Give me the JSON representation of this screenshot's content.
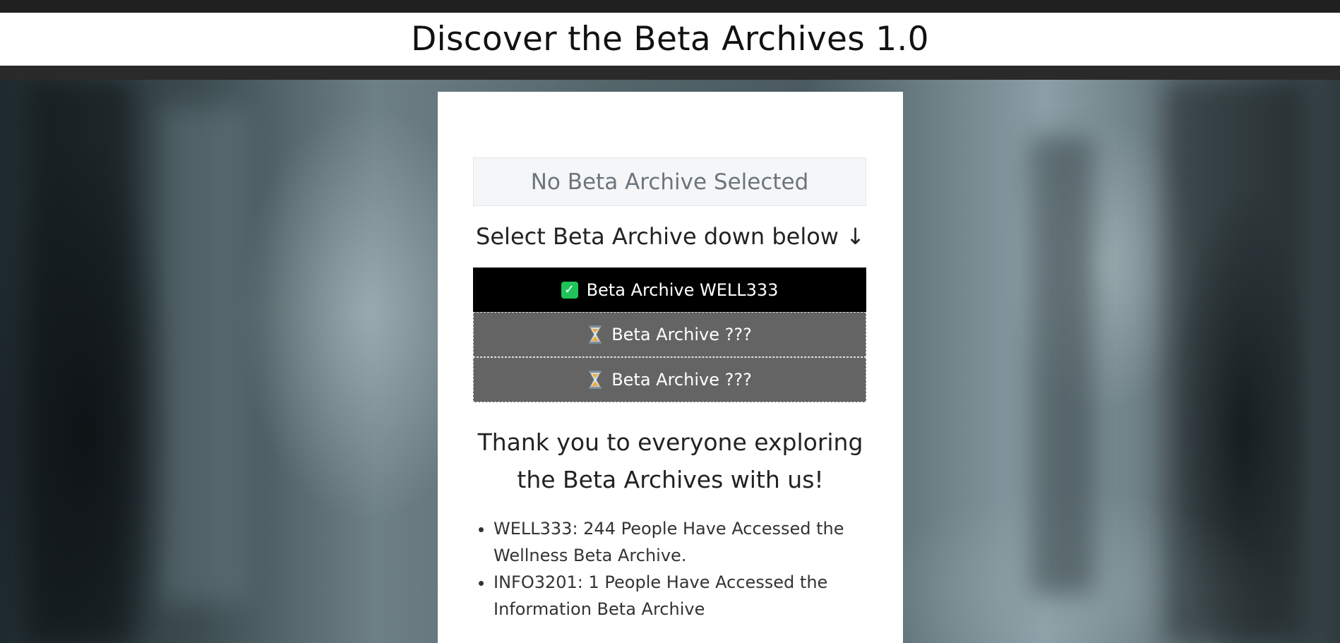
{
  "header": {
    "title": "Discover the Beta Archives 1.0"
  },
  "status": {
    "text": "No Beta Archive Selected"
  },
  "instruction": {
    "text": "Select Beta Archive down below ↓"
  },
  "archives": [
    {
      "label": "Beta Archive WELL333",
      "state": "unlocked",
      "icon": "check-icon"
    },
    {
      "label": "Beta Archive ???",
      "state": "locked",
      "icon": "hourglass-icon"
    },
    {
      "label": "Beta Archive ???",
      "state": "locked",
      "icon": "hourglass-icon"
    }
  ],
  "thanks": {
    "line1": "Thank you to everyone exploring",
    "line2": "the Beta Archives with us!"
  },
  "stats": [
    "WELL333: 244 People Have Accessed the Wellness Beta Archive.",
    "INFO3201: 1 People Have Accessed the Information Beta Archive"
  ],
  "colors": {
    "active_button": "#000000",
    "locked_button": "#646464",
    "check": "#20c35a"
  }
}
